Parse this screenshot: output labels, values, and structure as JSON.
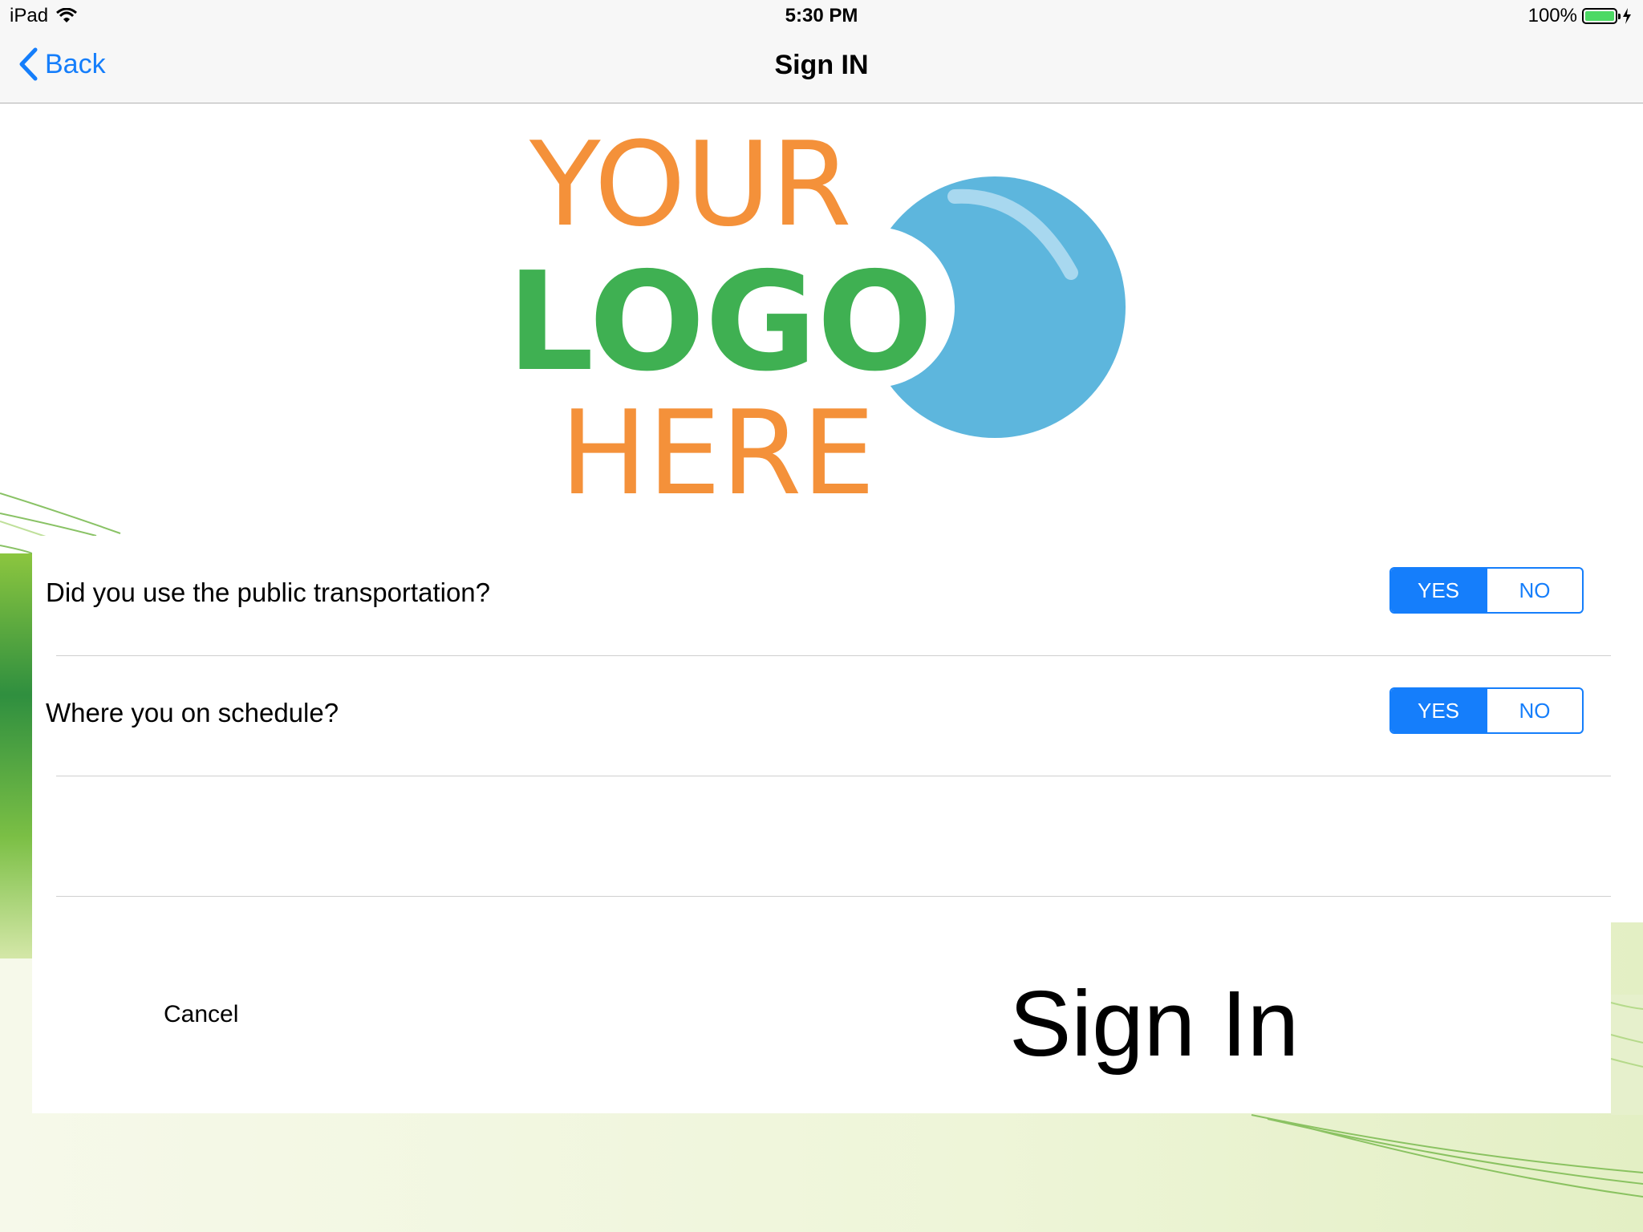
{
  "status_bar": {
    "device": "iPad",
    "time": "5:30 PM",
    "battery": "100%"
  },
  "nav": {
    "back_label": "Back",
    "title": "Sign IN"
  },
  "logo": {
    "line1": "YOUR",
    "line2": "LOGO",
    "line3": "HERE"
  },
  "questions": [
    {
      "label": "Did you use the public transportation?",
      "yes": "YES",
      "no": "NO",
      "selected": "YES"
    },
    {
      "label": "Where you on schedule?",
      "yes": "YES",
      "no": "NO",
      "selected": "YES"
    }
  ],
  "actions": {
    "cancel_label": "Cancel",
    "signin_label": "Sign In"
  },
  "colors": {
    "accent": "#157efb",
    "logo_orange": "#f4913a",
    "logo_green": "#3fb052",
    "logo_blue": "#5db6dd"
  }
}
